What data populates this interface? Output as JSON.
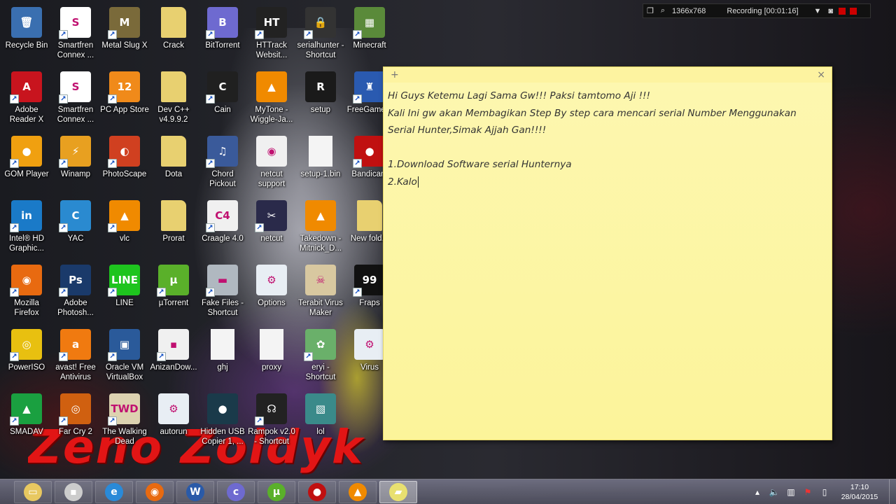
{
  "desktop": {
    "icons": [
      {
        "label": "Recycle Bin",
        "icon": "recycle-bin-icon",
        "color": "#3a6fb0",
        "glyph": "🗑",
        "shortcut": false
      },
      {
        "label": "Smartfren Connex ...",
        "icon": "smartfren-icon",
        "color": "#ffffff",
        "glyph": "S",
        "shortcut": true
      },
      {
        "label": "Metal Slug X",
        "icon": "metal-slug-icon",
        "color": "#7a6a3a",
        "glyph": "M",
        "shortcut": true
      },
      {
        "label": "Crack",
        "icon": "folder-icon",
        "color": "#e8d070",
        "glyph": "",
        "shortcut": false
      },
      {
        "label": "BitTorrent",
        "icon": "bittorrent-icon",
        "color": "#6e6ad0",
        "glyph": "B",
        "shortcut": true
      },
      {
        "label": "HTTrack Websit...",
        "icon": "httrack-icon",
        "color": "#222222",
        "glyph": "HT",
        "shortcut": true
      },
      {
        "label": "serialhunter - Shortcut",
        "icon": "lock-icon",
        "color": "#333333",
        "glyph": "🔒",
        "shortcut": true
      },
      {
        "label": "Minecraft",
        "icon": "minecraft-icon",
        "color": "#5a8a3a",
        "glyph": "▦",
        "shortcut": true
      },
      {
        "label": "Adobe Reader X",
        "icon": "adobe-reader-icon",
        "color": "#c8141e",
        "glyph": "A",
        "shortcut": true
      },
      {
        "label": "Smartfren Connex ...",
        "icon": "smartfren-icon",
        "color": "#ffffff",
        "glyph": "S",
        "shortcut": true
      },
      {
        "label": "PC App Store",
        "icon": "pc-app-store-icon",
        "color": "#f08a1a",
        "glyph": "12",
        "shortcut": true
      },
      {
        "label": "Dev C++ v4.9.9.2",
        "icon": "folder-icon",
        "color": "#e8d070",
        "glyph": "",
        "shortcut": false
      },
      {
        "label": "Cain",
        "icon": "cain-icon",
        "color": "#202020",
        "glyph": "C",
        "shortcut": true
      },
      {
        "label": "MyTone -Wiggle-Ja...",
        "icon": "vlc-icon",
        "color": "#f08a00",
        "glyph": "▲",
        "shortcut": false
      },
      {
        "label": "setup",
        "icon": "setup-icon",
        "color": "#1a1a1a",
        "glyph": "R",
        "shortcut": false
      },
      {
        "label": "FreeGame...",
        "icon": "freegame-icon",
        "color": "#2a5ab0",
        "glyph": "♜",
        "shortcut": true
      },
      {
        "label": "GOM Player",
        "icon": "gom-player-icon",
        "color": "#f0a010",
        "glyph": "●",
        "shortcut": true
      },
      {
        "label": "Winamp",
        "icon": "winamp-icon",
        "color": "#e8a020",
        "glyph": "⚡",
        "shortcut": true
      },
      {
        "label": "PhotoScape",
        "icon": "photoscape-icon",
        "color": "#d04020",
        "glyph": "◐",
        "shortcut": true
      },
      {
        "label": "Dota",
        "icon": "folder-icon",
        "color": "#e8d070",
        "glyph": "",
        "shortcut": false
      },
      {
        "label": "Chord Pickout",
        "icon": "chord-pickout-icon",
        "color": "#3a5a9a",
        "glyph": "♫",
        "shortcut": true
      },
      {
        "label": "netcut support",
        "icon": "firefox-doc-icon",
        "color": "#f0f0f0",
        "glyph": "◉",
        "shortcut": false
      },
      {
        "label": "setup-1.bin",
        "icon": "file-icon",
        "color": "#f4f4f4",
        "glyph": "",
        "shortcut": false
      },
      {
        "label": "Bandicam",
        "icon": "bandicam-icon",
        "color": "#c01010",
        "glyph": "●",
        "shortcut": true
      },
      {
        "label": "Intel® HD Graphic...",
        "icon": "intel-hd-icon",
        "color": "#1a7ac8",
        "glyph": "in",
        "shortcut": true
      },
      {
        "label": "YAC",
        "icon": "yac-icon",
        "color": "#2a8ad0",
        "glyph": "C",
        "shortcut": true
      },
      {
        "label": "vlc",
        "icon": "vlc-icon",
        "color": "#f08a00",
        "glyph": "▲",
        "shortcut": true
      },
      {
        "label": "Prorat",
        "icon": "folder-icon",
        "color": "#e8d070",
        "glyph": "",
        "shortcut": false
      },
      {
        "label": "Craagle 4.0",
        "icon": "craagle-icon",
        "color": "#f0f0f0",
        "glyph": "C4",
        "shortcut": true
      },
      {
        "label": "netcut",
        "icon": "netcut-icon",
        "color": "#2a2a4a",
        "glyph": "✂",
        "shortcut": true
      },
      {
        "label": "Takedown - Mitnick_D...",
        "icon": "vlc-icon",
        "color": "#f08a00",
        "glyph": "▲",
        "shortcut": false
      },
      {
        "label": "New fold...",
        "icon": "folder-icon",
        "color": "#e8d070",
        "glyph": "",
        "shortcut": false
      },
      {
        "label": "Mozilla Firefox",
        "icon": "firefox-icon",
        "color": "#e86a10",
        "glyph": "◉",
        "shortcut": true
      },
      {
        "label": "Adobe Photosh...",
        "icon": "photoshop-icon",
        "color": "#1a3a6a",
        "glyph": "Ps",
        "shortcut": true
      },
      {
        "label": "LINE",
        "icon": "line-icon",
        "color": "#1ec41e",
        "glyph": "LINE",
        "shortcut": true
      },
      {
        "label": "µTorrent",
        "icon": "utorrent-icon",
        "color": "#5ab02a",
        "glyph": "µ",
        "shortcut": true
      },
      {
        "label": "Fake Files - Shortcut",
        "icon": "drive-icon",
        "color": "#b0b8c0",
        "glyph": "▬",
        "shortcut": true
      },
      {
        "label": "Options",
        "icon": "options-icon",
        "color": "#e8eef4",
        "glyph": "⚙",
        "shortcut": false
      },
      {
        "label": "Terabit Virus Maker",
        "icon": "skull-icon",
        "color": "#d8c8a0",
        "glyph": "☠",
        "shortcut": false
      },
      {
        "label": "Fraps",
        "icon": "fraps-icon",
        "color": "#111111",
        "glyph": "99",
        "shortcut": true
      },
      {
        "label": "PowerISO",
        "icon": "poweriso-icon",
        "color": "#e8c010",
        "glyph": "◎",
        "shortcut": true
      },
      {
        "label": "avast! Free Antivirus",
        "icon": "avast-icon",
        "color": "#f07a10",
        "glyph": "a",
        "shortcut": true
      },
      {
        "label": "Oracle VM VirtualBox",
        "icon": "virtualbox-icon",
        "color": "#2a5a9a",
        "glyph": "▣",
        "shortcut": true
      },
      {
        "label": "AnizanDow...",
        "icon": "anizan-icon",
        "color": "#f0f0f0",
        "glyph": "▪",
        "shortcut": true
      },
      {
        "label": "ghj",
        "icon": "file-icon",
        "color": "#f4f4f4",
        "glyph": "",
        "shortcut": false
      },
      {
        "label": "proxy",
        "icon": "file-icon",
        "color": "#f4f4f4",
        "glyph": "",
        "shortcut": false
      },
      {
        "label": "eryi - Shortcut",
        "icon": "eryi-icon",
        "color": "#6ab06a",
        "glyph": "✿",
        "shortcut": true
      },
      {
        "label": "Virus",
        "icon": "options-icon",
        "color": "#e8eef4",
        "glyph": "⚙",
        "shortcut": false
      },
      {
        "label": "SMADAV",
        "icon": "smadav-icon",
        "color": "#1aa040",
        "glyph": "▲",
        "shortcut": true
      },
      {
        "label": "Far Cry 2",
        "icon": "farcry-icon",
        "color": "#d06010",
        "glyph": "◎",
        "shortcut": true
      },
      {
        "label": "The Walking Dead",
        "icon": "walking-dead-icon",
        "color": "#ddd2b0",
        "glyph": "TWD",
        "shortcut": true
      },
      {
        "label": "autorun",
        "icon": "options-icon",
        "color": "#e8eef4",
        "glyph": "⚙",
        "shortcut": false
      },
      {
        "label": "Hidden USB Copier 1, ...",
        "icon": "hidden-usb-icon",
        "color": "#1a3a4a",
        "glyph": "●",
        "shortcut": false
      },
      {
        "label": "Rampok v2.0 - Shortcut",
        "icon": "rampok-icon",
        "color": "#222222",
        "glyph": "☊",
        "shortcut": true
      },
      {
        "label": "lol",
        "icon": "lol-icon",
        "color": "#3a8a8a",
        "glyph": "▧",
        "shortcut": false
      }
    ]
  },
  "watermark": {
    "text": "Zeno Zoldyk",
    "color": "#e21515"
  },
  "recorder": {
    "resolution": "1366x768",
    "status": "Recording [00:01:16]"
  },
  "sticky_note": {
    "add_glyph": "+",
    "close_glyph": "×",
    "lines": [
      "Hi Guys Ketemu Lagi Sama Gw!!! Paksi tamtomo Aji !!!",
      "Kali Ini gw akan Membagikan Step By step cara mencari serial Number Menggunakan",
      "Serial Hunter,Simak Ajjah Gan!!!!",
      "",
      "1.Download Software serial Hunternya",
      "2.Kalo"
    ]
  },
  "taskbar": {
    "buttons": [
      {
        "name": "file-explorer",
        "icon": "folder-icon",
        "glyph": "▭",
        "color": "#e8c860",
        "active": false
      },
      {
        "name": "tool-app",
        "icon": "tool-icon",
        "glyph": "▪",
        "color": "#cccccc",
        "active": false
      },
      {
        "name": "internet-explorer",
        "icon": "internet-explorer-icon",
        "glyph": "e",
        "color": "#2a8ad8",
        "active": false
      },
      {
        "name": "firefox",
        "icon": "firefox-icon",
        "glyph": "◉",
        "color": "#e86a10",
        "active": false
      },
      {
        "name": "word",
        "icon": "word-icon",
        "glyph": "W",
        "color": "#2a5aa8",
        "active": false
      },
      {
        "name": "bittorrent",
        "icon": "bittorrent-icon",
        "glyph": "c",
        "color": "#6e6ad0",
        "active": false
      },
      {
        "name": "utorrent",
        "icon": "utorrent-icon",
        "glyph": "µ",
        "color": "#5ab02a",
        "active": false
      },
      {
        "name": "bandicam",
        "icon": "record-icon",
        "glyph": "●",
        "color": "#c01010",
        "active": false
      },
      {
        "name": "vlc",
        "icon": "vlc-icon",
        "glyph": "▲",
        "color": "#f08a00",
        "active": false
      },
      {
        "name": "sticky-notes",
        "icon": "sticky-notes-icon",
        "glyph": "▰",
        "color": "#e8e070",
        "active": true
      }
    ],
    "time": "17:10",
    "date": "28/04/2015"
  }
}
